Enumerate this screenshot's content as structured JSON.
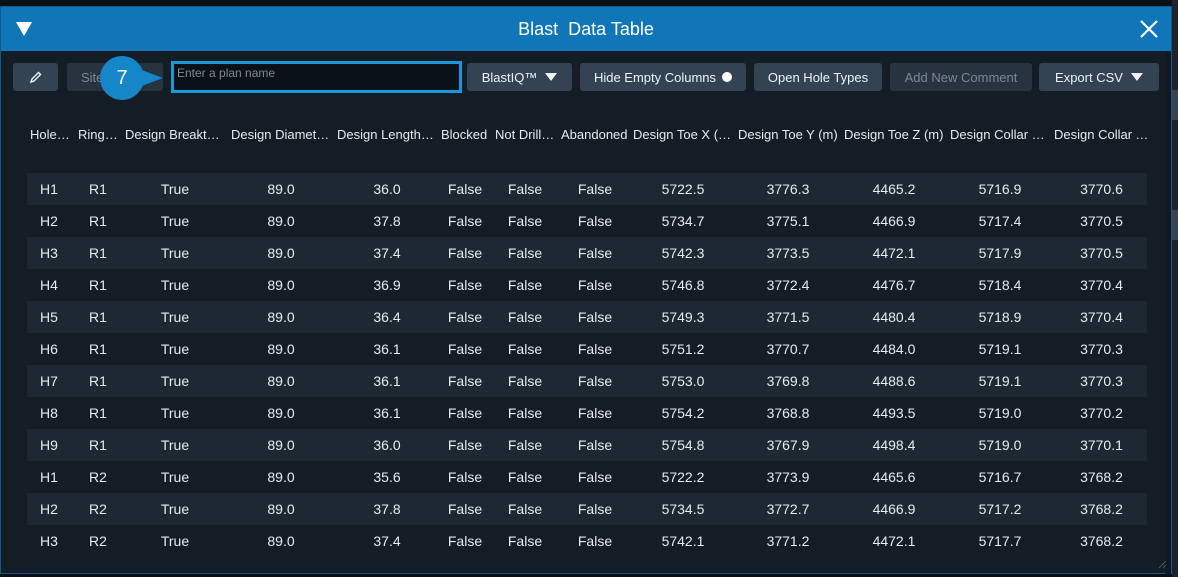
{
  "window": {
    "title": "Blast  Data Table"
  },
  "toolbar": {
    "site_label": "Site",
    "plan_input_placeholder": "Enter a plan name",
    "plan_input_value": "",
    "blastiq_label": "BlastIQ™",
    "hide_empty_label": "Hide Empty Columns",
    "open_hole_types_label": "Open Hole Types",
    "add_comment_label": "Add New Comment",
    "export_label": "Export CSV"
  },
  "step_marker": {
    "number": "7"
  },
  "colors": {
    "accent": "#1076b7",
    "highlight": "#1a97d8",
    "background": "#141c25",
    "row_alt": "#1e2833"
  },
  "icons": {
    "collapse": "triangle-down-icon",
    "close": "close-icon",
    "edit": "pencil-icon",
    "dropdown": "caret-down-icon",
    "toggle": "dot-icon"
  },
  "table": {
    "columns": [
      "Hole ID",
      "Ring ID",
      "Design Breakthr...",
      "Design Diamete...",
      "Design Length (...",
      "Blocked",
      "Not Drilled",
      "Abandoned",
      "Design Toe X (m)",
      "Design Toe Y (m)",
      "Design Toe Z (m)",
      "Design Collar X ...",
      "Design Collar Y ..."
    ],
    "rows": [
      [
        "H1",
        "R1",
        "True",
        "89.0",
        "36.0",
        "False",
        "False",
        "False",
        "5722.5",
        "3776.3",
        "4465.2",
        "5716.9",
        "3770.6"
      ],
      [
        "H2",
        "R1",
        "True",
        "89.0",
        "37.8",
        "False",
        "False",
        "False",
        "5734.7",
        "3775.1",
        "4466.9",
        "5717.4",
        "3770.5"
      ],
      [
        "H3",
        "R1",
        "True",
        "89.0",
        "37.4",
        "False",
        "False",
        "False",
        "5742.3",
        "3773.5",
        "4472.1",
        "5717.9",
        "3770.5"
      ],
      [
        "H4",
        "R1",
        "True",
        "89.0",
        "36.9",
        "False",
        "False",
        "False",
        "5746.8",
        "3772.4",
        "4476.7",
        "5718.4",
        "3770.4"
      ],
      [
        "H5",
        "R1",
        "True",
        "89.0",
        "36.4",
        "False",
        "False",
        "False",
        "5749.3",
        "3771.5",
        "4480.4",
        "5718.9",
        "3770.4"
      ],
      [
        "H6",
        "R1",
        "True",
        "89.0",
        "36.1",
        "False",
        "False",
        "False",
        "5751.2",
        "3770.7",
        "4484.0",
        "5719.1",
        "3770.3"
      ],
      [
        "H7",
        "R1",
        "True",
        "89.0",
        "36.1",
        "False",
        "False",
        "False",
        "5753.0",
        "3769.8",
        "4488.6",
        "5719.1",
        "3770.3"
      ],
      [
        "H8",
        "R1",
        "True",
        "89.0",
        "36.1",
        "False",
        "False",
        "False",
        "5754.2",
        "3768.8",
        "4493.5",
        "5719.0",
        "3770.2"
      ],
      [
        "H9",
        "R1",
        "True",
        "89.0",
        "36.0",
        "False",
        "False",
        "False",
        "5754.8",
        "3767.9",
        "4498.4",
        "5719.0",
        "3770.1"
      ],
      [
        "H1",
        "R2",
        "True",
        "89.0",
        "35.6",
        "False",
        "False",
        "False",
        "5722.2",
        "3773.9",
        "4465.6",
        "5716.7",
        "3768.2"
      ],
      [
        "H2",
        "R2",
        "True",
        "89.0",
        "37.8",
        "False",
        "False",
        "False",
        "5734.5",
        "3772.7",
        "4466.9",
        "5717.2",
        "3768.2"
      ],
      [
        "H3",
        "R2",
        "True",
        "89.0",
        "37.4",
        "False",
        "False",
        "False",
        "5742.1",
        "3771.2",
        "4472.1",
        "5717.7",
        "3768.2"
      ]
    ]
  }
}
